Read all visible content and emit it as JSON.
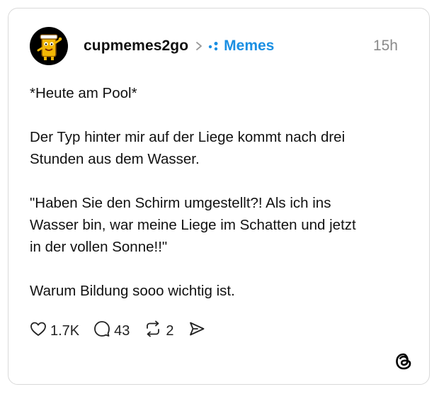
{
  "post": {
    "username": "cupmemes2go",
    "community": "Memes",
    "timestamp": "15h",
    "paragraphs": [
      "*Heute am Pool*",
      "Der Typ hinter mir auf der Liege kommt nach drei\nStunden aus dem Wasser.",
      "\"Haben Sie den Schirm umgestellt?! Als ich ins\nWasser bin, war meine Liege im Schatten und jetzt\nin der vollen Sonne!!\"",
      "Warum Bildung sooo wichtig ist."
    ],
    "stats": {
      "likes": "1.7K",
      "replies": "43",
      "reposts": "2"
    }
  },
  "colors": {
    "community_accent": "#1a8fe3",
    "timestamp": "#8a8a8a",
    "border": "#d9d9d9"
  },
  "icons": [
    "avatar-cup-mascot",
    "chevron-right-icon",
    "community-dots-icon",
    "heart-icon",
    "comment-icon",
    "repost-icon",
    "share-icon",
    "threads-logo-icon"
  ]
}
